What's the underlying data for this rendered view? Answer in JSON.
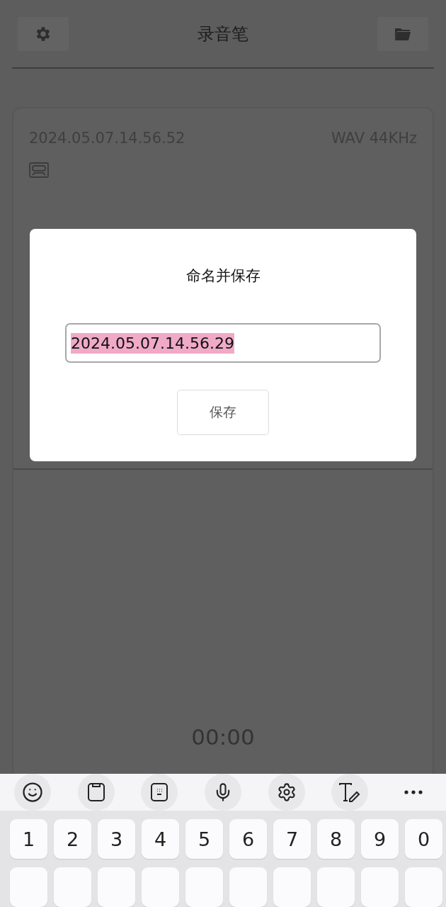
{
  "app": {
    "title": "录音笔"
  },
  "recording": {
    "name": "2024.05.07.14.56.52",
    "format": "WAV 44KHz",
    "timer": "00:00"
  },
  "dialog": {
    "title": "命名并保存",
    "input": {
      "value": "2024.05.07.14.56.29",
      "text_selected": true
    },
    "button": "保存"
  },
  "keyboard": {
    "number_keys": [
      "1",
      "2",
      "3",
      "4",
      "5",
      "6",
      "7",
      "8",
      "9",
      "0"
    ]
  }
}
